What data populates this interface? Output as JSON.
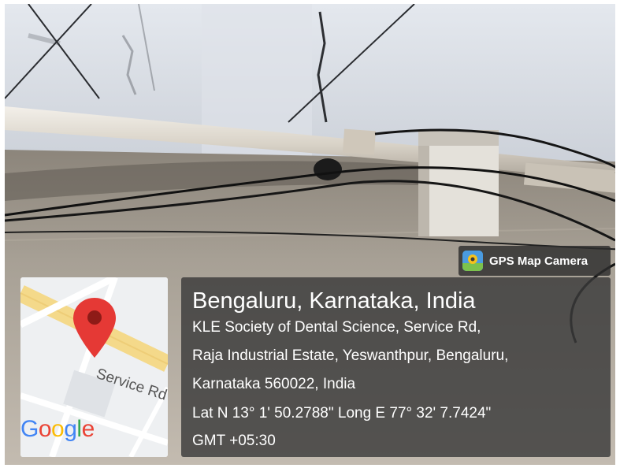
{
  "badge": {
    "label": "GPS Map Camera",
    "icon": "gps-map-camera-app-icon"
  },
  "map": {
    "road_label": "Service Rd",
    "logo": {
      "text": "Google",
      "letters": [
        "G",
        "o",
        "o",
        "g",
        "l",
        "e"
      ],
      "colors": [
        "#4285F4",
        "#EA4335",
        "#FBBC05",
        "#4285F4",
        "#34A853",
        "#EA4335"
      ]
    },
    "pin_color": "#E53935"
  },
  "location": {
    "title": "Bengaluru, Karnataka, India",
    "address_line1": "KLE Society of Dental Science, Service Rd,",
    "address_line2": "Raja Industrial Estate, Yeswanthpur, Bengaluru,",
    "address_line3": "Karnataka 560022, India",
    "coordinates": "Lat N 13° 1' 50.2788\" Long E 77° 32' 7.7424\"",
    "timezone": "GMT +05:30"
  }
}
